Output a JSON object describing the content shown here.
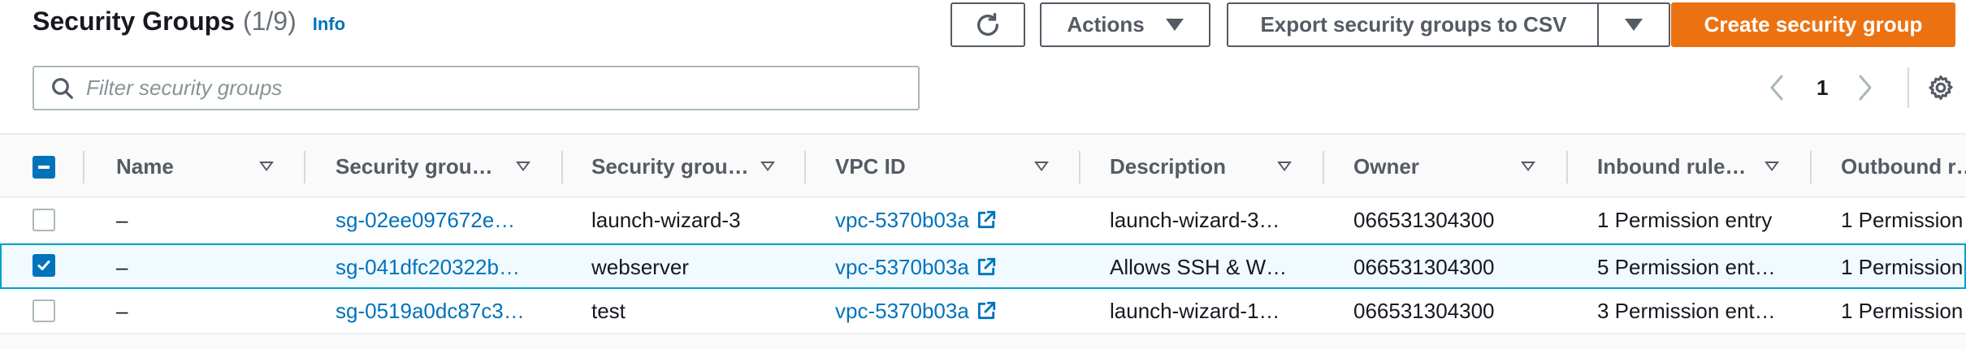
{
  "header": {
    "title": "Security Groups",
    "count": "(1/9)",
    "info_link": "Info"
  },
  "toolbar": {
    "refresh_icon": "refresh-icon",
    "actions_label": "Actions",
    "export_label": "Export security groups to CSV",
    "create_label": "Create security group"
  },
  "filter": {
    "placeholder": "Filter security groups",
    "value": ""
  },
  "pagination": {
    "current_page": "1"
  },
  "table": {
    "columns": [
      "Name",
      "Security grou…",
      "Security grou…",
      "VPC ID",
      "Description",
      "Owner",
      "Inbound rule…",
      "Outbound r…"
    ],
    "rows": [
      {
        "selected": false,
        "name": "–",
        "group_id": "sg-02ee097672e…",
        "group_name": "launch-wizard-3",
        "vpc_id": "vpc-5370b03a",
        "description": "launch-wizard-3…",
        "owner": "066531304300",
        "inbound": "1 Permission entry",
        "outbound": "1 Permission"
      },
      {
        "selected": true,
        "name": "–",
        "group_id": "sg-041dfc20322b…",
        "group_name": "webserver",
        "vpc_id": "vpc-5370b03a",
        "description": "Allows SSH & W…",
        "owner": "066531304300",
        "inbound": "5 Permission ent…",
        "outbound": "1 Permission"
      },
      {
        "selected": false,
        "name": "–",
        "group_id": "sg-0519a0dc87c3…",
        "group_name": "test",
        "vpc_id": "vpc-5370b03a",
        "description": "launch-wizard-1…",
        "owner": "066531304300",
        "inbound": "3 Permission ent…",
        "outbound": "1 Permission"
      }
    ]
  },
  "colors": {
    "accent": "#ec7211",
    "link": "#0073bb",
    "selected_row_bg": "#f1faff",
    "selected_row_border": "#00a1c9"
  }
}
